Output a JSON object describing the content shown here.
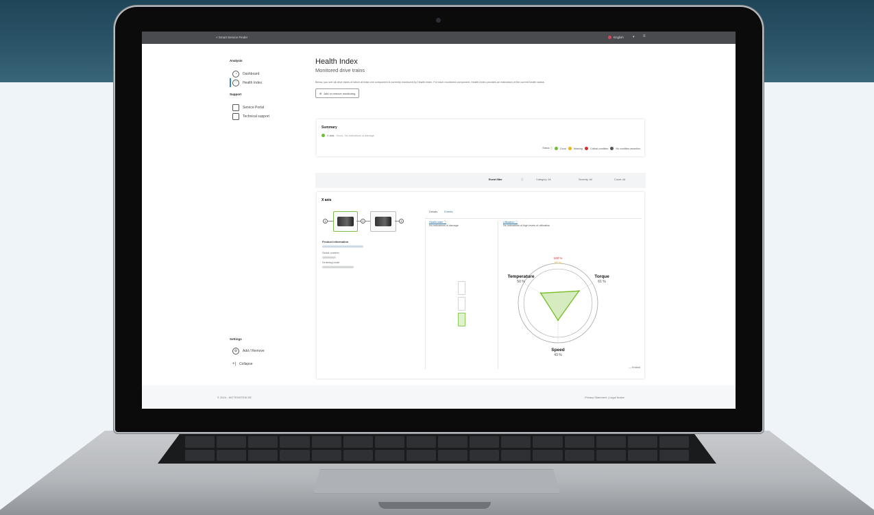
{
  "app": {
    "back_label": "< Smart Service Finder",
    "language": "English",
    "menu_glyph": "≡"
  },
  "sidebar": {
    "analysis_title": "Analysis",
    "items": [
      {
        "label": "Dashboard",
        "icon": "gauge-icon"
      },
      {
        "label": "Health Index",
        "icon": "heart-icon"
      }
    ],
    "support_title": "Support",
    "support_items": [
      {
        "label": "Service Portal",
        "icon": "portal-icon"
      },
      {
        "label": "Technical support",
        "icon": "support-icon"
      }
    ],
    "settings_title": "Settings",
    "settings_items": [
      {
        "label": "Add / Remove",
        "icon": "gear-icon"
      },
      {
        "label": "Collapse",
        "icon": "collapse-icon"
      }
    ]
  },
  "main": {
    "title": "Health Index",
    "subtitle": "Monitored drive trains",
    "description": "Below, you see all drive trains of which at least one component is currently monitored by Health Index. For each monitored component, Health Index provides an estimation of the current health status.",
    "add_button": "Add or remove monitoring"
  },
  "summary": {
    "heading": "Summary",
    "axis_label": "X axis",
    "axis_status": "Good - No indications of damage",
    "status_label": "Status ⓘ",
    "legend": [
      {
        "label": "Good",
        "color": "#6bbf2f"
      },
      {
        "label": "Warning",
        "color": "#f2b705"
      },
      {
        "label": "Critical condition",
        "color": "#d72d2d"
      },
      {
        "label": "No condition assertion",
        "color": "#555555"
      }
    ]
  },
  "filters": {
    "event_filter": "Event filter",
    "category": "Category: All",
    "severity": "Severity: All",
    "count": "Count: All"
  },
  "axis": {
    "heading": "X axis",
    "nodes": [
      "1",
      "2",
      "3"
    ],
    "product_info_title": "Product information",
    "serial_label": "Serial number",
    "ordering_label": "Ordering code",
    "tabs": [
      {
        "label": "Details"
      },
      {
        "label": "Events"
      }
    ],
    "health_state_label": "Health state ⓘ",
    "health_state_value": "No indications of damage",
    "utilization_label": "Utilization ⓘ",
    "utilization_value": "No indications of high levels of utilization",
    "embed_label": "— Embed"
  },
  "chart_data": {
    "type": "radar",
    "axes": [
      "Temperature",
      "Torque",
      "Speed"
    ],
    "values": [
      50,
      61,
      43
    ],
    "value_labels": [
      "50 %",
      "61 %",
      "43 %"
    ],
    "max_label": "100 %",
    "warn_label": "80 %",
    "colors": {
      "fill": "#d6ebc0",
      "stroke": "#7cbf2f",
      "max": "#d72d2d",
      "warn": "#f2b705"
    }
  },
  "footer": {
    "copyright": "© 2024 - WITTENSTEIN SE",
    "privacy": "Privacy Statement",
    "separator": "|",
    "legal": "Legal Notice"
  }
}
